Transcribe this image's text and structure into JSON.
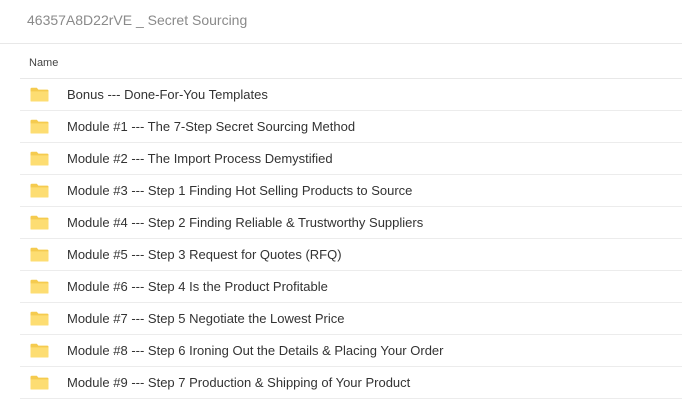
{
  "header": {
    "folder_title": "46357A8D22rVE _ Secret Sourcing"
  },
  "list": {
    "column_name": "Name",
    "folder_color": "#fddd72",
    "folder_tab_color": "#f5cb4f",
    "items": [
      {
        "label": "Bonus --- Done-For-You Templates",
        "icon": "folder-icon"
      },
      {
        "label": "Module #1 --- The 7-Step Secret Sourcing Method",
        "icon": "folder-icon"
      },
      {
        "label": "Module #2 --- The Import Process Demystified",
        "icon": "folder-icon"
      },
      {
        "label": "Module #3 --- Step 1 Finding Hot Selling Products to Source",
        "icon": "folder-icon"
      },
      {
        "label": "Module #4 --- Step 2 Finding Reliable & Trustworthy Suppliers",
        "icon": "folder-icon"
      },
      {
        "label": "Module #5 --- Step 3 Request for Quotes (RFQ)",
        "icon": "folder-icon"
      },
      {
        "label": "Module #6 --- Step 4 Is the Product Profitable",
        "icon": "folder-icon"
      },
      {
        "label": "Module #7 --- Step 5 Negotiate the Lowest Price",
        "icon": "folder-icon"
      },
      {
        "label": "Module #8 --- Step 6 Ironing Out the Details & Placing Your Order",
        "icon": "folder-icon"
      },
      {
        "label": "Module #9 --- Step 7 Production & Shipping of Your Product",
        "icon": "folder-icon"
      }
    ]
  }
}
